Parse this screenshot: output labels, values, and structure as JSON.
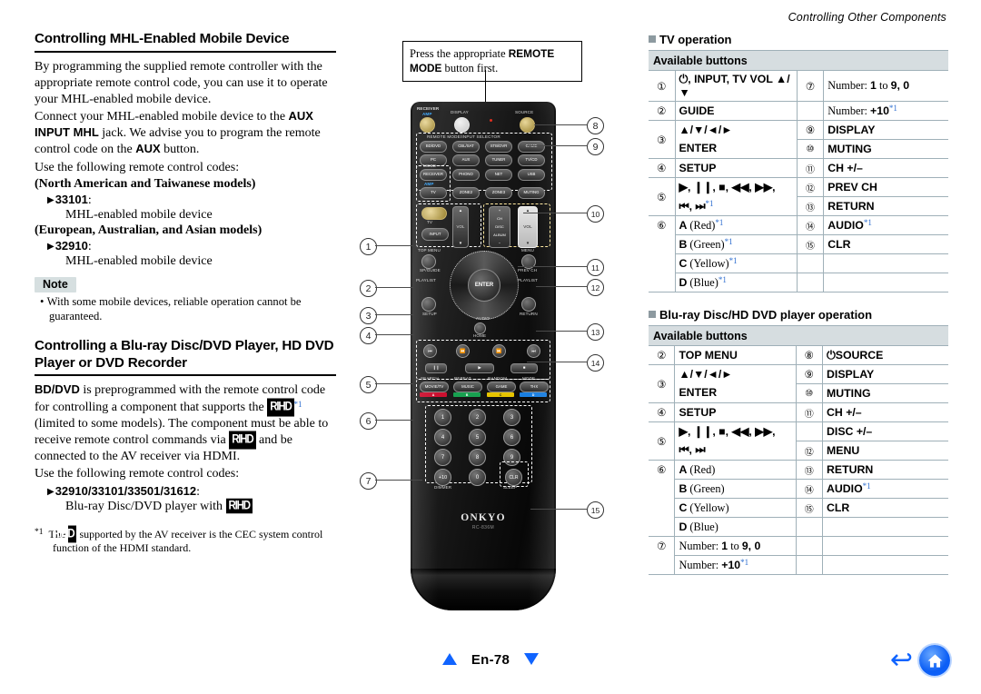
{
  "running_head": "Controlling Other Components",
  "left_column": {
    "heading_1": "Controlling MHL-Enabled Mobile Device",
    "para_1": "By programming the supplied remote controller with the appropriate remote control code, you can use it to operate your MHL-enabled mobile device.",
    "para_2_pre": "Connect your MHL-enabled mobile device to the ",
    "para_2_b1": "AUX INPUT MHL",
    "para_2_mid": " jack. We advise you to program the remote control code on the ",
    "para_2_b2": "AUX",
    "para_2_end": " button.",
    "use_codes_1": "Use the following remote control codes:",
    "model_group_1": "(North American and Taiwanese models)",
    "code_1": "33101",
    "code_1_desc": "MHL-enabled mobile device",
    "model_group_2": "(European, Australian, and Asian models)",
    "code_2": "32910",
    "code_2_desc": "MHL-enabled mobile device",
    "note_label": "Note",
    "note_text": "With some mobile devices, reliable operation cannot be guaranteed.",
    "heading_2": "Controlling a Blu-ray Disc/DVD Player, HD DVD Player or DVD Recorder",
    "para_3_b": "BD/DVD",
    "para_3_a": " is preprogrammed with the remote control code for controlling a component that supports the ",
    "rihd_logo": "RIHD",
    "para_3_b2": " (limited to some models). The component must be able to receive remote control commands via ",
    "para_3_c": " and be connected to the AV receiver via HDMI.",
    "use_codes_2": "Use the following remote control codes:",
    "code_3": "32910/33101/33501/31612",
    "code_3_desc_pre": "Blu-ray Disc/DVD player with ",
    "footnote_mark": "*1",
    "footnote_pre": "The ",
    "footnote_post": " supported by the AV receiver is the CEC system control function of the HDMI standard."
  },
  "callout_tip": {
    "text_pre": "Press the appropriate ",
    "text_bold": "REMOTE MODE",
    "text_post": " button first."
  },
  "remote": {
    "brand": "ONKYO",
    "model": "RC-836M",
    "labels": {
      "receiver": "RECEIVER",
      "amp": "AMP",
      "display": "DISPLAY",
      "source": "SOURCE",
      "remote_mode_selector": "REMOTE MODE/INPUT SELECTOR",
      "mode": "MODE",
      "tv": "TV",
      "vol": "VOL",
      "ch": "CH",
      "disc": "DISC",
      "album": "ALBUM",
      "top_menu": "TOP MENU",
      "menu": "MENU",
      "sp_guide": "SP/GUIDE",
      "prev_ch": "PREV CH",
      "playlist_l": "PLAYLIST",
      "playlist_r": "PLAYLIST",
      "setup": "SETUP",
      "return": "RETURN",
      "audio": "AUDIO",
      "home": "HOME",
      "search": "SEARCH",
      "repeat": "REPEAT",
      "random": "RANDOM",
      "mode2": "MODE",
      "dimmer": "DIMMER",
      "sleep": "SLEEP",
      "q_setup": "Q"
    },
    "selector_buttons": [
      "BD/DVD",
      "CBL/SAT",
      "STB/DVR",
      "GAME",
      "PC",
      "AUX",
      "TUNER",
      "TV/CD",
      "RECEIVER",
      "PHONO",
      "NET",
      "USB",
      "TV",
      "ZONE2",
      "ZONE3",
      "MUTING"
    ],
    "transport_buttons": [
      "MOVIE/TV",
      "MUSIC",
      "GAME",
      "THX"
    ],
    "color_tags": [
      "A",
      "B",
      "C",
      "D"
    ],
    "color_hex": [
      "#cc1030",
      "#18a050",
      "#e6c400",
      "#1a7fe0"
    ],
    "numpad": [
      "1",
      "2",
      "3",
      "4",
      "5",
      "6",
      "7",
      "8",
      "9",
      "+10",
      "0",
      "CLR"
    ],
    "enter": "ENTER",
    "input": "INPUT"
  },
  "callout_numbers_left": [
    "1",
    "2",
    "3",
    "4",
    "5",
    "6",
    "7"
  ],
  "callout_numbers_right": [
    "8",
    "9",
    "10",
    "11",
    "12",
    "13",
    "14",
    "15"
  ],
  "right_column": {
    "table1": {
      "title": "TV operation",
      "header": "Available buttons",
      "rows": [
        {
          "n": "1",
          "label": "power, INPUT, TV VOL up/down",
          "n2": "7",
          "label2": "Number: 1 to 9, 0"
        },
        {
          "n": "2",
          "label": "GUIDE",
          "n2": "",
          "label2": "Number: +10*1"
        },
        {
          "n": "3",
          "label": "up/down/left/right",
          "n2": "9",
          "label2": "DISPLAY"
        },
        {
          "n": "",
          "label": "ENTER",
          "n2": "10",
          "label2": "MUTING"
        },
        {
          "n": "4",
          "label": "SETUP",
          "n2": "11",
          "label2": "CH +/-"
        },
        {
          "n": "5",
          "label": "play, pause, stop, rew, ff,",
          "n2": "12",
          "label2": "PREV CH"
        },
        {
          "n": "",
          "label": "prev, next*1",
          "n2": "13",
          "label2": "RETURN"
        },
        {
          "n": "6",
          "label": "A (Red)*1",
          "n2": "14",
          "label2": "AUDIO*1"
        },
        {
          "n": "",
          "label": "B (Green)*1",
          "n2": "15",
          "label2": "CLR"
        },
        {
          "n": "",
          "label": "C (Yellow)*1",
          "n2": "",
          "label2": ""
        },
        {
          "n": "",
          "label": "D (Blue)*1",
          "n2": "",
          "label2": ""
        }
      ]
    },
    "table2": {
      "title": "Blu-ray Disc/HD DVD player operation",
      "header": "Available buttons",
      "rows": [
        {
          "n": "2",
          "label": "TOP MENU",
          "n2": "8",
          "label2": "powerSOURCE"
        },
        {
          "n": "3",
          "label": "up/down/left/right",
          "n2": "9",
          "label2": "DISPLAY"
        },
        {
          "n": "",
          "label": "ENTER",
          "n2": "10",
          "label2": "MUTING"
        },
        {
          "n": "4",
          "label": "SETUP",
          "n2": "11",
          "label2": "CH +/-"
        },
        {
          "n": "5",
          "label": "play, pause, stop, rew, ff,",
          "n2": "",
          "label2": "DISC +/-"
        },
        {
          "n": "",
          "label": "prev, next",
          "n2": "12",
          "label2": "MENU"
        },
        {
          "n": "6",
          "label": "A (Red)",
          "n2": "13",
          "label2": "RETURN"
        },
        {
          "n": "",
          "label": "B (Green)",
          "n2": "14",
          "label2": "AUDIO*1"
        },
        {
          "n": "",
          "label": "C (Yellow)",
          "n2": "15",
          "label2": "CLR"
        },
        {
          "n": "",
          "label": "D (Blue)",
          "n2": "",
          "label2": ""
        },
        {
          "n": "7",
          "label": "Number: 1 to 9, 0",
          "n2": "",
          "label2": ""
        },
        {
          "n": "",
          "label": "Number: +10*1",
          "n2": "",
          "label2": ""
        }
      ]
    }
  },
  "footer": {
    "page_label": "En-78",
    "up_arrow": "triangle-up-icon",
    "down_arrow": "triangle-down-icon",
    "back_icon": "back-arrow-icon",
    "home_icon": "home-icon"
  }
}
